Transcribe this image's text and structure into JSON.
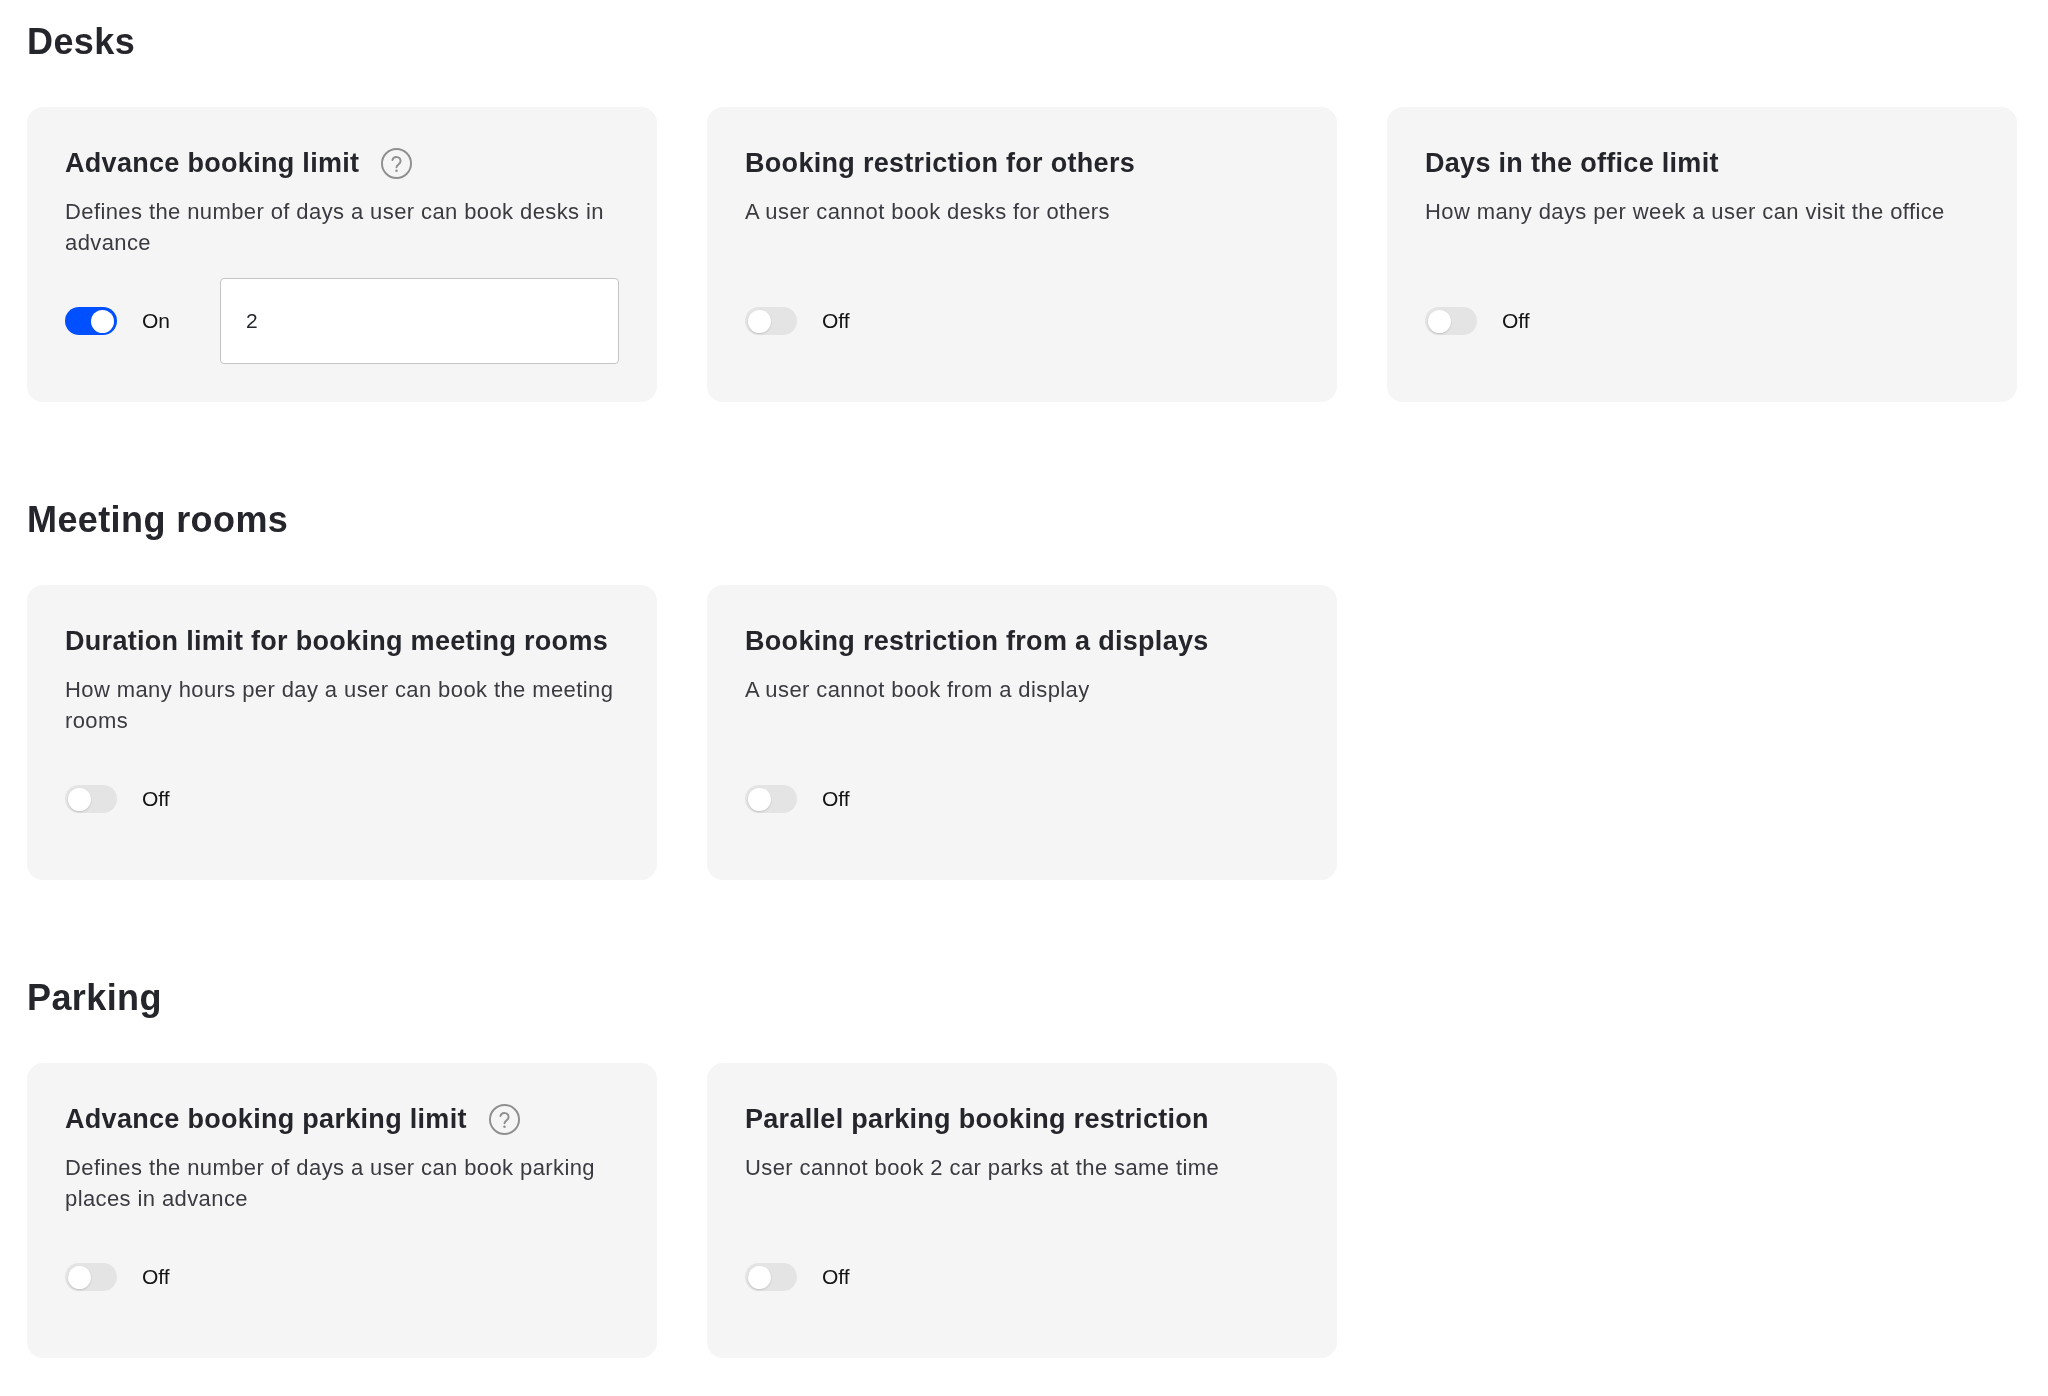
{
  "sections": [
    {
      "title": "Desks",
      "cards": [
        {
          "title": "Advance booking limit",
          "help": true,
          "description": "Defines the number of days a user can book desks in advance",
          "toggle": {
            "on": true,
            "label": "On"
          },
          "input": {
            "value": "2"
          }
        },
        {
          "title": "Booking restriction for others",
          "help": false,
          "description": "A user cannot book desks for others",
          "toggle": {
            "on": false,
            "label": "Off"
          }
        },
        {
          "title": "Days in the office limit",
          "help": false,
          "description": "How many days per week a user can visit the office",
          "toggle": {
            "on": false,
            "label": "Off"
          }
        }
      ]
    },
    {
      "title": "Meeting rooms",
      "cards": [
        {
          "title": "Duration limit for booking meeting rooms",
          "help": false,
          "description": "How many hours per day a user can book the meeting rooms",
          "toggle": {
            "on": false,
            "label": "Off"
          }
        },
        {
          "title": "Booking restriction from a displays",
          "help": false,
          "description": "A user cannot book from a display",
          "toggle": {
            "on": false,
            "label": "Off"
          }
        }
      ]
    },
    {
      "title": "Parking",
      "cards": [
        {
          "title": "Advance booking parking limit",
          "help": true,
          "description": "Defines the number of days a user can book parking places in advance",
          "toggle": {
            "on": false,
            "label": "Off"
          }
        },
        {
          "title": "Parallel parking booking restriction",
          "help": false,
          "description": "User cannot book 2 car parks at the same time",
          "toggle": {
            "on": false,
            "label": "Off"
          }
        }
      ]
    }
  ]
}
